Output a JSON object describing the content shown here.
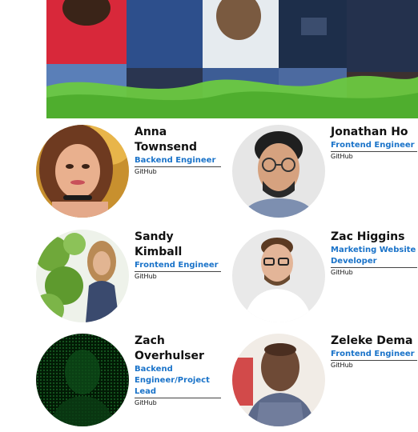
{
  "team": {
    "members": [
      {
        "name_line1": "Anna",
        "name_line2": "Townsend",
        "role": "Backend Engineer",
        "link": "GitHub"
      },
      {
        "name_line1": "Jonathan Ho",
        "name_line2": "",
        "role": "Frontend Engineer",
        "link": "GitHub"
      },
      {
        "name_line1": "Sandy Kimball",
        "name_line2": "",
        "role": "Frontend Engineer",
        "link": "GitHub"
      },
      {
        "name_line1": "Zac Higgins",
        "name_line2": "",
        "role": "Marketing Website Developer",
        "link": "GitHub"
      },
      {
        "name_line1": "Zach",
        "name_line2": "Overhulser",
        "role": "Backend Engineer/Project Lead",
        "link": "GitHub"
      },
      {
        "name_line1": "Zeleke Dema",
        "name_line2": "",
        "role": "Frontend Engineer",
        "link": "GitHub"
      }
    ]
  },
  "colors": {
    "link_blue": "#1a73c9",
    "hero_green": "#5fc23a"
  }
}
